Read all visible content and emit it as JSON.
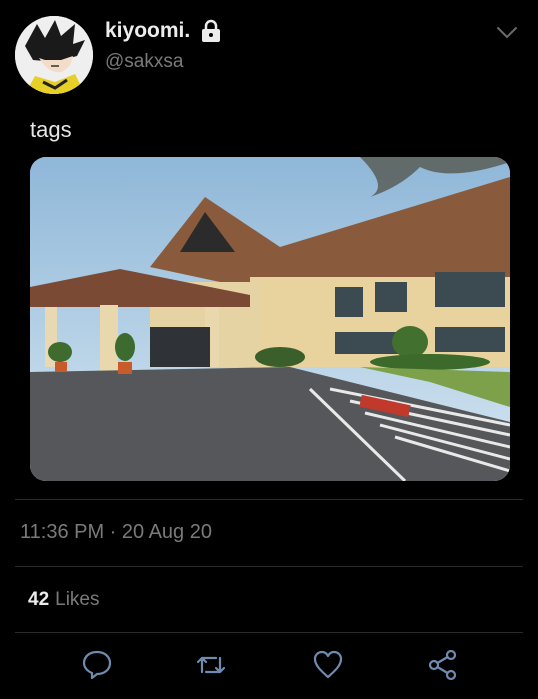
{
  "user": {
    "display_name": "kiyoomi.",
    "handle": "@sakxsa",
    "protected": true,
    "avatar": "anime-avatar"
  },
  "tweet": {
    "text": "tags",
    "media": "photo-hotel-building"
  },
  "meta": {
    "timestamp": "11:36 PM · 20 Aug 20",
    "likes_count": "42",
    "likes_label": "Likes"
  },
  "actions": [
    "reply-icon",
    "retweet-icon",
    "like-icon",
    "share-icon"
  ],
  "colors": {
    "background": "#000000",
    "text_primary": "#ececec",
    "text_secondary": "#7a7a7a",
    "icon": "#6f8cb0"
  }
}
